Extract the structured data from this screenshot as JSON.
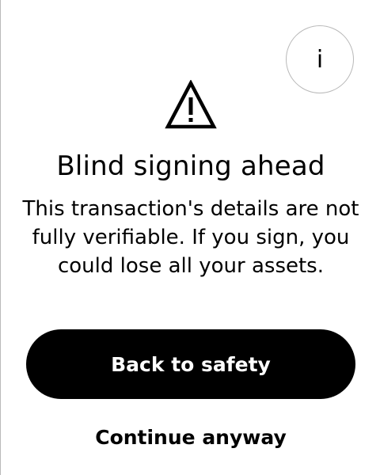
{
  "header": {
    "info_button": {
      "icon": "info-icon",
      "glyph": "i"
    }
  },
  "alert": {
    "icon": "warning-triangle-icon",
    "title": "Blind signing ahead",
    "message": "This transaction's details are not fully verifiable. If you sign, you could lose all your assets."
  },
  "actions": {
    "primary_label": "Back to safety",
    "secondary_label": "Continue anyway"
  },
  "colors": {
    "background": "#ffffff",
    "primary_button": "#000000",
    "primary_text": "#ffffff",
    "text": "#000000",
    "circle_border": "#b8b8b8"
  }
}
